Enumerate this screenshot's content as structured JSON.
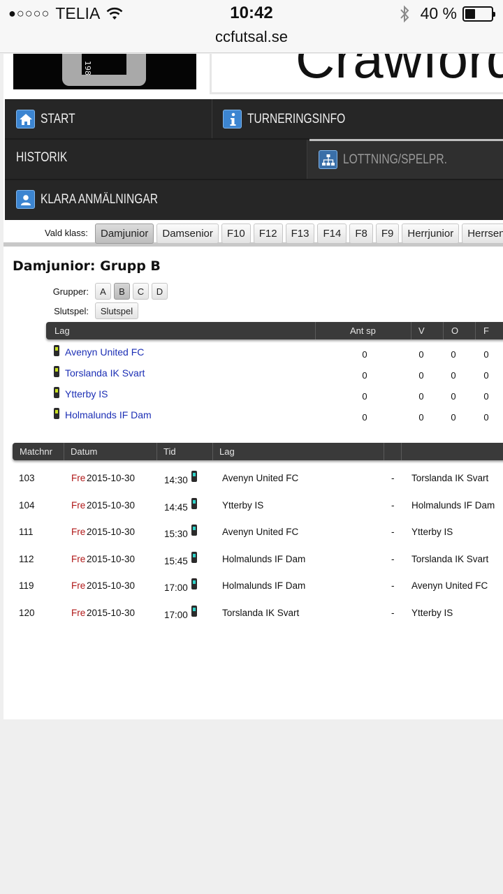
{
  "status": {
    "signal_dots": "●○○○○",
    "carrier": "TELIA",
    "time": "10:42",
    "battery_text": "40 %",
    "battery_level": 0.4,
    "url": "ccfutsal.se"
  },
  "header": {
    "logo_digits": "198",
    "banner_text": "Crawford"
  },
  "nav": {
    "start": "START",
    "turneringsinfo": "TURNERINGSINFO",
    "historik": "HISTORIK",
    "lottning": "LOTTNING/SPELPR.",
    "klara": "KLARA ANMÄLNINGAR"
  },
  "classes": {
    "label": "Vald klass:",
    "selected": "Damjunior",
    "items": [
      "Damjunior",
      "Damsenior",
      "F10",
      "F12",
      "F13",
      "F14",
      "F8",
      "F9",
      "Herrjunior",
      "Herrsenior"
    ]
  },
  "group": {
    "title": "Damjunior: Grupp B",
    "grupper_label": "Grupper:",
    "grupper": [
      "A",
      "B",
      "C",
      "D"
    ],
    "selected_group": "B",
    "slutspel_label": "Slutspel:",
    "slutspel_button": "Slutspel"
  },
  "standings": {
    "headers": [
      "Lag",
      "Ant sp",
      "V",
      "O",
      "F"
    ],
    "rows": [
      {
        "team": "Avenyn United FC",
        "ant_sp": "0",
        "v": "0",
        "o": "0",
        "f": "0"
      },
      {
        "team": "Torslanda IK Svart",
        "ant_sp": "0",
        "v": "0",
        "o": "0",
        "f": "0"
      },
      {
        "team": "Ytterby IS",
        "ant_sp": "0",
        "v": "0",
        "o": "0",
        "f": "0"
      },
      {
        "team": "Holmalunds IF Dam",
        "ant_sp": "0",
        "v": "0",
        "o": "0",
        "f": "0"
      }
    ]
  },
  "matches": {
    "headers": [
      "Matchnr",
      "Datum",
      "Tid",
      "Lag"
    ],
    "rows": [
      {
        "nr": "103",
        "day": "Fre",
        "date": "2015-10-30",
        "time": "14:30",
        "home": "Avenyn United FC",
        "sep": "-",
        "away": "Torslanda IK Svart"
      },
      {
        "nr": "104",
        "day": "Fre",
        "date": "2015-10-30",
        "time": "14:45",
        "home": "Ytterby IS",
        "sep": "-",
        "away": "Holmalunds IF Dam"
      },
      {
        "nr": "111",
        "day": "Fre",
        "date": "2015-10-30",
        "time": "15:30",
        "home": "Avenyn United FC",
        "sep": "-",
        "away": "Ytterby IS"
      },
      {
        "nr": "112",
        "day": "Fre",
        "date": "2015-10-30",
        "time": "15:45",
        "home": "Holmalunds IF Dam",
        "sep": "-",
        "away": "Torslanda IK Svart"
      },
      {
        "nr": "119",
        "day": "Fre",
        "date": "2015-10-30",
        "time": "17:00",
        "home": "Holmalunds IF Dam",
        "sep": "-",
        "away": "Avenyn United FC"
      },
      {
        "nr": "120",
        "day": "Fre",
        "date": "2015-10-30",
        "time": "17:00",
        "home": "Torslanda IK Svart",
        "sep": "-",
        "away": "Ytterby IS"
      }
    ]
  },
  "colors": {
    "nav_bg": "#262626",
    "nav_icon": "#3c85d1",
    "link": "#1c2fb5",
    "day": "#b01818"
  }
}
